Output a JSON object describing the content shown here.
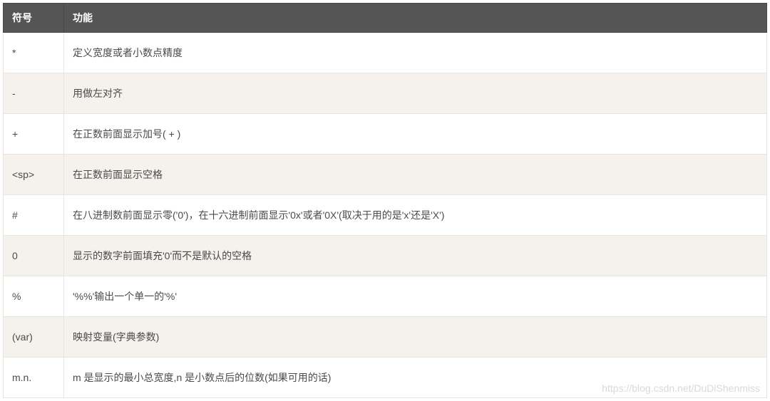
{
  "table": {
    "headers": {
      "symbol": "符号",
      "function": "功能"
    },
    "rows": [
      {
        "symbol": "*",
        "function": "定义宽度或者小数点精度"
      },
      {
        "symbol": "-",
        "function": "用做左对齐"
      },
      {
        "symbol": "+",
        "function": "在正数前面显示加号( + )"
      },
      {
        "symbol": "<sp>",
        "function": "在正数前面显示空格"
      },
      {
        "symbol": "#",
        "function": "在八进制数前面显示零('0')，在十六进制前面显示'0x'或者'0X'(取决于用的是'x'还是'X')"
      },
      {
        "symbol": "0",
        "function": "显示的数字前面填充'0'而不是默认的空格"
      },
      {
        "symbol": "%",
        "function": "'%%'输出一个单一的'%'"
      },
      {
        "symbol": "(var)",
        "function": "映射变量(字典参数)"
      },
      {
        "symbol": "m.n.",
        "function": "m 是显示的最小总宽度,n 是小数点后的位数(如果可用的话)"
      }
    ]
  },
  "watermark": "https://blog.csdn.net/DuDiShenmiss"
}
